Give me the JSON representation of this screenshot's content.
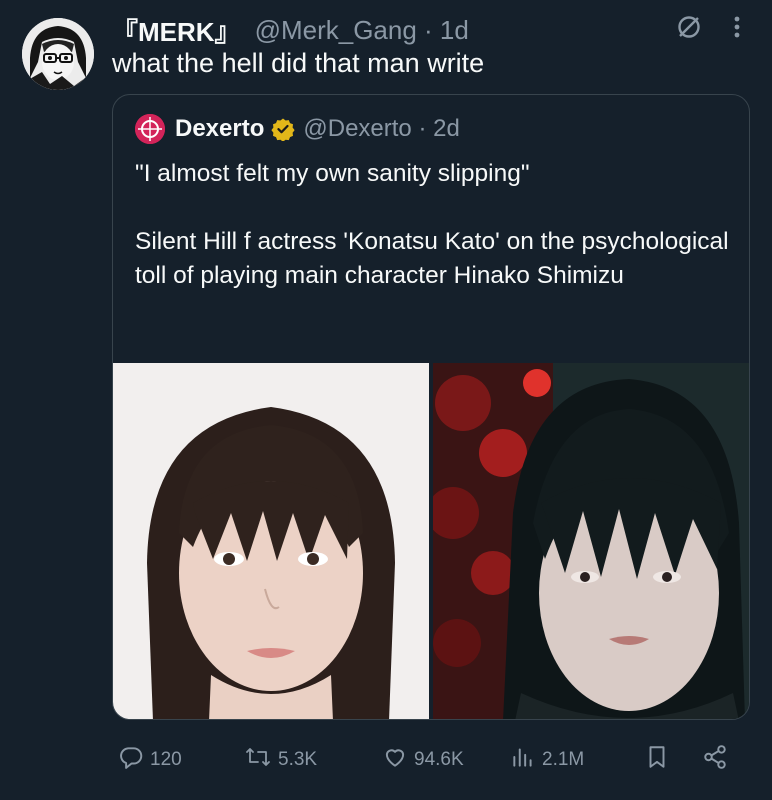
{
  "tweet": {
    "display_name": "『MERK』",
    "handle": "@Merk_Gang",
    "time": "· 1d",
    "text": "what the hell did that man write"
  },
  "quoted": {
    "display_name": "Dexerto",
    "handle": "@Dexerto",
    "time": "· 2d",
    "line1": "\"I almost felt my own sanity slipping\"",
    "line2": "Silent Hill f actress 'Konatsu Kato' on the psychological toll of playing main character Hinako Shimizu"
  },
  "actions": {
    "replies": "120",
    "retweets": "5.3K",
    "likes": "94.6K",
    "views": "2.1M"
  },
  "icons": {
    "verified": "verified-badge-icon",
    "grok": "grok-icon",
    "more": "more-icon",
    "reply": "reply-icon",
    "retweet": "retweet-icon",
    "like": "heart-icon",
    "views": "analytics-icon",
    "bookmark": "bookmark-icon",
    "share": "share-icon"
  },
  "colors": {
    "background": "#15202b",
    "text": "#f7f9f9",
    "secondary": "#8b98a5",
    "border": "#38444d",
    "verified_gold": "#e2b719"
  }
}
